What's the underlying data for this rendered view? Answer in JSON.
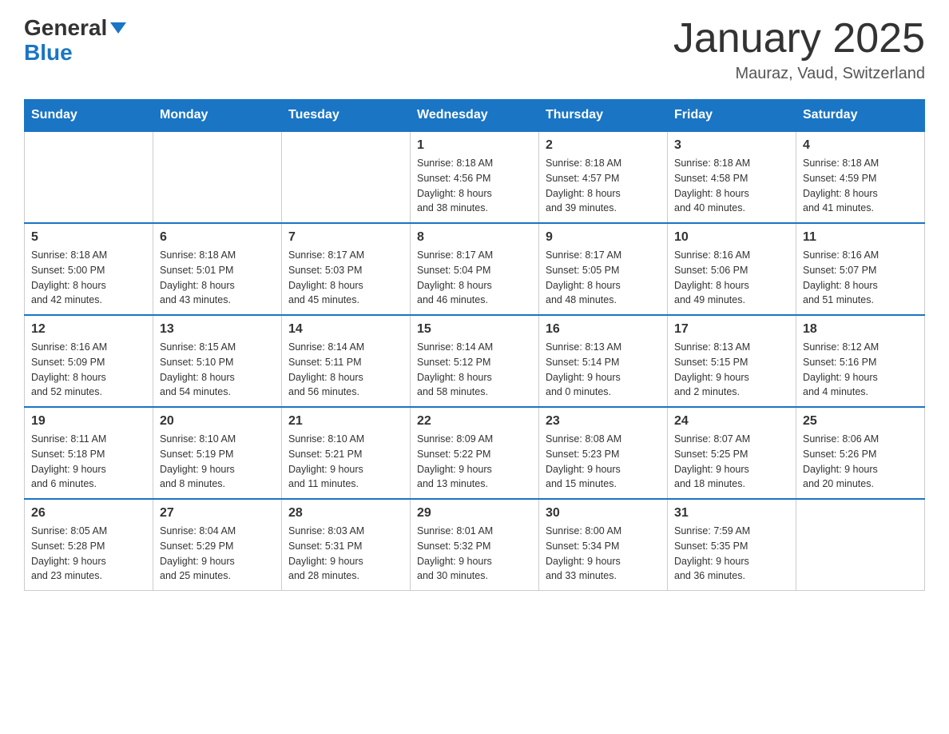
{
  "header": {
    "logo_line1": "General",
    "logo_line2": "Blue",
    "month_title": "January 2025",
    "location": "Mauraz, Vaud, Switzerland"
  },
  "weekdays": [
    "Sunday",
    "Monday",
    "Tuesday",
    "Wednesday",
    "Thursday",
    "Friday",
    "Saturday"
  ],
  "weeks": [
    [
      {
        "day": "",
        "info": ""
      },
      {
        "day": "",
        "info": ""
      },
      {
        "day": "",
        "info": ""
      },
      {
        "day": "1",
        "info": "Sunrise: 8:18 AM\nSunset: 4:56 PM\nDaylight: 8 hours\nand 38 minutes."
      },
      {
        "day": "2",
        "info": "Sunrise: 8:18 AM\nSunset: 4:57 PM\nDaylight: 8 hours\nand 39 minutes."
      },
      {
        "day": "3",
        "info": "Sunrise: 8:18 AM\nSunset: 4:58 PM\nDaylight: 8 hours\nand 40 minutes."
      },
      {
        "day": "4",
        "info": "Sunrise: 8:18 AM\nSunset: 4:59 PM\nDaylight: 8 hours\nand 41 minutes."
      }
    ],
    [
      {
        "day": "5",
        "info": "Sunrise: 8:18 AM\nSunset: 5:00 PM\nDaylight: 8 hours\nand 42 minutes."
      },
      {
        "day": "6",
        "info": "Sunrise: 8:18 AM\nSunset: 5:01 PM\nDaylight: 8 hours\nand 43 minutes."
      },
      {
        "day": "7",
        "info": "Sunrise: 8:17 AM\nSunset: 5:03 PM\nDaylight: 8 hours\nand 45 minutes."
      },
      {
        "day": "8",
        "info": "Sunrise: 8:17 AM\nSunset: 5:04 PM\nDaylight: 8 hours\nand 46 minutes."
      },
      {
        "day": "9",
        "info": "Sunrise: 8:17 AM\nSunset: 5:05 PM\nDaylight: 8 hours\nand 48 minutes."
      },
      {
        "day": "10",
        "info": "Sunrise: 8:16 AM\nSunset: 5:06 PM\nDaylight: 8 hours\nand 49 minutes."
      },
      {
        "day": "11",
        "info": "Sunrise: 8:16 AM\nSunset: 5:07 PM\nDaylight: 8 hours\nand 51 minutes."
      }
    ],
    [
      {
        "day": "12",
        "info": "Sunrise: 8:16 AM\nSunset: 5:09 PM\nDaylight: 8 hours\nand 52 minutes."
      },
      {
        "day": "13",
        "info": "Sunrise: 8:15 AM\nSunset: 5:10 PM\nDaylight: 8 hours\nand 54 minutes."
      },
      {
        "day": "14",
        "info": "Sunrise: 8:14 AM\nSunset: 5:11 PM\nDaylight: 8 hours\nand 56 minutes."
      },
      {
        "day": "15",
        "info": "Sunrise: 8:14 AM\nSunset: 5:12 PM\nDaylight: 8 hours\nand 58 minutes."
      },
      {
        "day": "16",
        "info": "Sunrise: 8:13 AM\nSunset: 5:14 PM\nDaylight: 9 hours\nand 0 minutes."
      },
      {
        "day": "17",
        "info": "Sunrise: 8:13 AM\nSunset: 5:15 PM\nDaylight: 9 hours\nand 2 minutes."
      },
      {
        "day": "18",
        "info": "Sunrise: 8:12 AM\nSunset: 5:16 PM\nDaylight: 9 hours\nand 4 minutes."
      }
    ],
    [
      {
        "day": "19",
        "info": "Sunrise: 8:11 AM\nSunset: 5:18 PM\nDaylight: 9 hours\nand 6 minutes."
      },
      {
        "day": "20",
        "info": "Sunrise: 8:10 AM\nSunset: 5:19 PM\nDaylight: 9 hours\nand 8 minutes."
      },
      {
        "day": "21",
        "info": "Sunrise: 8:10 AM\nSunset: 5:21 PM\nDaylight: 9 hours\nand 11 minutes."
      },
      {
        "day": "22",
        "info": "Sunrise: 8:09 AM\nSunset: 5:22 PM\nDaylight: 9 hours\nand 13 minutes."
      },
      {
        "day": "23",
        "info": "Sunrise: 8:08 AM\nSunset: 5:23 PM\nDaylight: 9 hours\nand 15 minutes."
      },
      {
        "day": "24",
        "info": "Sunrise: 8:07 AM\nSunset: 5:25 PM\nDaylight: 9 hours\nand 18 minutes."
      },
      {
        "day": "25",
        "info": "Sunrise: 8:06 AM\nSunset: 5:26 PM\nDaylight: 9 hours\nand 20 minutes."
      }
    ],
    [
      {
        "day": "26",
        "info": "Sunrise: 8:05 AM\nSunset: 5:28 PM\nDaylight: 9 hours\nand 23 minutes."
      },
      {
        "day": "27",
        "info": "Sunrise: 8:04 AM\nSunset: 5:29 PM\nDaylight: 9 hours\nand 25 minutes."
      },
      {
        "day": "28",
        "info": "Sunrise: 8:03 AM\nSunset: 5:31 PM\nDaylight: 9 hours\nand 28 minutes."
      },
      {
        "day": "29",
        "info": "Sunrise: 8:01 AM\nSunset: 5:32 PM\nDaylight: 9 hours\nand 30 minutes."
      },
      {
        "day": "30",
        "info": "Sunrise: 8:00 AM\nSunset: 5:34 PM\nDaylight: 9 hours\nand 33 minutes."
      },
      {
        "day": "31",
        "info": "Sunrise: 7:59 AM\nSunset: 5:35 PM\nDaylight: 9 hours\nand 36 minutes."
      },
      {
        "day": "",
        "info": ""
      }
    ]
  ]
}
